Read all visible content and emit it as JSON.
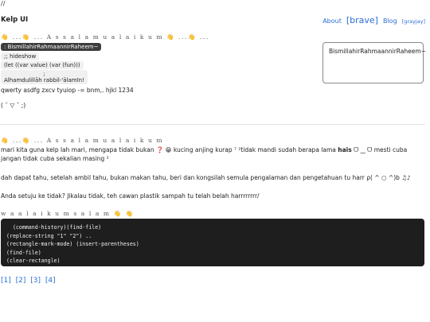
{
  "top_mark": "//",
  "brand": "Kelp UI",
  "nav": {
    "about": "About",
    "brave": "[brave]",
    "blog": "Blog",
    "grayjay": "[grayjay]"
  },
  "section1": {
    "greeting": "👋 ...👋 ... A s s a l a m u a l a i k u m 👋 ...👋 ...",
    "pill": ": BismillahirRahmaannirRaheem~",
    "hideshow": ";; hideshow",
    "let": "(let ((var value) (var (fun)))",
    "semicolon": ";",
    "alhamdulillah": "Alhamdulillāh rabbil-'ālamīn!",
    "qwerty": "qwerty asdfg zxcv tyuiop -= bnm,. hjkl 1234",
    "kaomoji": "( ¯ ▽ ¯ ;)"
  },
  "card_text": "BismillahirRahmaannirRaheem~",
  "section2": {
    "greeting": "👋 ...👋 ... A s s a l a m u a l a i k u m",
    "para1": "mari kita guna kelp lah mari, mengapa tidak bukan ❓ 😁 kucing anjing kurap ⁷ ²tidak mandi sudah berapa lama",
    "para1_bold": "hais",
    "para1_tail": "ᗜ ‿ ᗜ mesti cuba jangan tidak cuba sekalian masing ²",
    "para2": "dah dapat tahu, setelah ambil tahu, bukan makan tahu, beri dan kongsilah semula pengalaman dan pengetahuan tu harr ρ( ^ ○ ^)b ♫♪",
    "para3": "Anda setuju ke tidak? Jikalau tidak, teh cawan plastik sampah tu telah belah harrrrrrrr/",
    "waalaikum": "w a a l a i k u m s a l a m 👋 👋"
  },
  "code_lines": [
    "  (command-history)(find-file)",
    "(replace-string \"1\" \"2\") ..",
    "(rectangle-mark-mode) (insert-parentheses)",
    "(find-file)",
    "(clear-rectangle)"
  ],
  "footer_links": [
    "[1]",
    "[2]",
    "[3]",
    "[4]"
  ]
}
